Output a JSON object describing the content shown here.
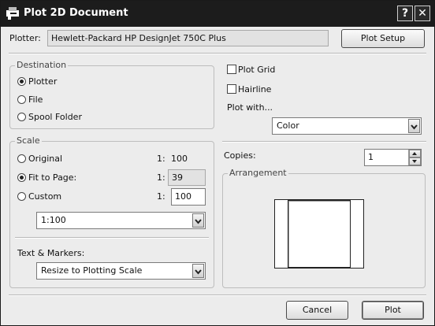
{
  "window": {
    "title": "Plot 2D Document",
    "help_label": "?",
    "close_label": "✕"
  },
  "plotter": {
    "label": "Plotter:",
    "value": "Hewlett-Packard HP DesignJet 750C Plus",
    "setup_button": "Plot Setup"
  },
  "destination": {
    "legend": "Destination",
    "options": [
      {
        "label": "Plotter",
        "selected": true
      },
      {
        "label": "File",
        "selected": false
      },
      {
        "label": "Spool Folder",
        "selected": false
      }
    ]
  },
  "scale": {
    "legend": "Scale",
    "original_label": "Original",
    "original_ratio": "1:",
    "original_value": "100",
    "fit_label": "Fit to Page:",
    "fit_ratio": "1:",
    "fit_value": "39",
    "custom_label": "Custom",
    "custom_ratio": "1:",
    "custom_value": "100",
    "preset_selected": "1:100",
    "selected": "Fit to Page"
  },
  "text_markers": {
    "label": "Text & Markers:",
    "selected": "Resize to Plotting Scale"
  },
  "options": {
    "plot_grid_label": "Plot Grid",
    "plot_grid_checked": false,
    "hairline_label": "Hairline",
    "hairline_checked": false,
    "plot_with_label": "Plot with...",
    "plot_with_selected": "Color"
  },
  "copies": {
    "label": "Copies:",
    "value": "1"
  },
  "arrangement": {
    "legend": "Arrangement"
  },
  "buttons": {
    "cancel": "Cancel",
    "plot": "Plot"
  }
}
